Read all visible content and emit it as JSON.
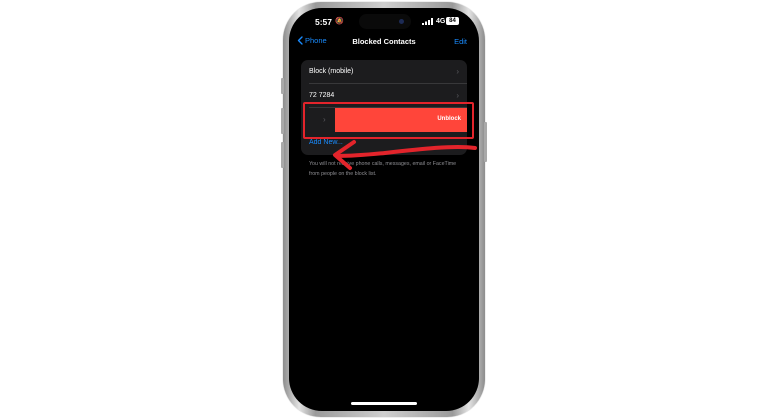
{
  "status_bar": {
    "time": "5:57",
    "network": "4G",
    "battery": "84"
  },
  "nav": {
    "back_label": "Phone",
    "title": "Blocked Contacts",
    "edit_label": "Edit"
  },
  "list": {
    "items": [
      {
        "label": "Block (mobile)"
      },
      {
        "label": "72 7284"
      }
    ],
    "swipe_action_label": "Unblock",
    "add_new_label": "Add New..."
  },
  "footer_text": "You will not receive phone calls, messages, email or FaceTime from people on the block list.",
  "colors": {
    "accent": "#1a8cff",
    "destructive": "#ff453a",
    "annotation": "#e3242b"
  },
  "icons": [
    "chevron-left-icon",
    "chevron-right-icon",
    "bell-slash-icon",
    "signal-icon",
    "battery-icon"
  ]
}
